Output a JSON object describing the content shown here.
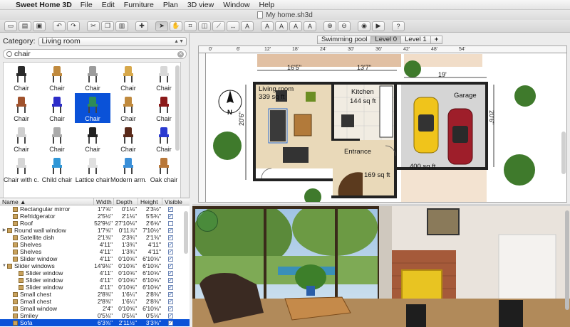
{
  "menubar": {
    "app_name": "Sweet Home 3D",
    "items": [
      "File",
      "Edit",
      "Furniture",
      "Plan",
      "3D view",
      "Window",
      "Help"
    ]
  },
  "window": {
    "title": "My home.sh3d"
  },
  "catalog": {
    "category_label": "Category:",
    "category_value": "Living room",
    "search_value": "chair",
    "items": [
      {
        "label": "Chair",
        "color": "#2a2a2a"
      },
      {
        "label": "Chair",
        "color": "#c08a3e"
      },
      {
        "label": "Chair",
        "color": "#9c9c9c"
      },
      {
        "label": "Chair",
        "color": "#d7a84b"
      },
      {
        "label": "Chair",
        "color": "#d8d8d8"
      },
      {
        "label": "Chair",
        "color": "#a0522d"
      },
      {
        "label": "Chair",
        "color": "#2d2dc8"
      },
      {
        "label": "Chair",
        "color": "#2e8b57"
      },
      {
        "label": "Chair",
        "color": "#c08a3e"
      },
      {
        "label": "Chair",
        "color": "#8b1a1a"
      },
      {
        "label": "Chair",
        "color": "#cfcfcf"
      },
      {
        "label": "Chair",
        "color": "#aaaaaa"
      },
      {
        "label": "Chair",
        "color": "#222222"
      },
      {
        "label": "Chair",
        "color": "#5a2a1a"
      },
      {
        "label": "Chair",
        "color": "#2a3ad0"
      },
      {
        "label": "Chair with c...",
        "color": "#d6d6d6"
      },
      {
        "label": "Child chair",
        "color": "#2f96d6"
      },
      {
        "label": "Lattice chair",
        "color": "#e0e0e0"
      },
      {
        "label": "Modern arm...",
        "color": "#3a8fd8"
      },
      {
        "label": "Oak chair",
        "color": "#b8783a"
      }
    ]
  },
  "table": {
    "headers": [
      "Name",
      "Width",
      "Depth",
      "Height",
      "Visible"
    ],
    "rows": [
      {
        "name": "Rectangular mirror",
        "w": "1'7⅝\"",
        "d": "0'1⅛\"",
        "h": "2'3½\"",
        "v": true,
        "indent": 1,
        "tw": ""
      },
      {
        "name": "Refridgerator",
        "w": "2'5½\"",
        "d": "2'1⅛\"",
        "h": "5'5¾\"",
        "v": true,
        "indent": 1,
        "tw": ""
      },
      {
        "name": "Roof",
        "w": "52'9½\"",
        "d": "27'10⅛\"",
        "h": "2'6⅝\"",
        "v": false,
        "indent": 1,
        "tw": ""
      },
      {
        "name": "Round wall window",
        "w": "1'7⅝\"",
        "d": "0'11⅞\"",
        "h": "7'10½\"",
        "v": true,
        "indent": 0,
        "tw": "▶"
      },
      {
        "name": "Satellite dish",
        "w": "2'1⅜\"",
        "d": "2'3¾\"",
        "h": "2'1⅜\"",
        "v": true,
        "indent": 1,
        "tw": ""
      },
      {
        "name": "Shelves",
        "w": "4'11\"",
        "d": "1'3¾\"",
        "h": "4'11\"",
        "v": true,
        "indent": 1,
        "tw": ""
      },
      {
        "name": "Shelves",
        "w": "4'11\"",
        "d": "1'3¾\"",
        "h": "4'11\"",
        "v": true,
        "indent": 1,
        "tw": ""
      },
      {
        "name": "Slider window",
        "w": "4'11\"",
        "d": "0'10⅝\"",
        "h": "6'10⅝\"",
        "v": true,
        "indent": 1,
        "tw": ""
      },
      {
        "name": "Slider windows",
        "w": "14'9⅛\"",
        "d": "0'10⅝\"",
        "h": "6'10⅝\"",
        "v": true,
        "indent": 0,
        "tw": "▼"
      },
      {
        "name": "Slider window",
        "w": "4'11\"",
        "d": "0'10⅝\"",
        "h": "6'10⅝\"",
        "v": true,
        "indent": 2,
        "tw": ""
      },
      {
        "name": "Slider window",
        "w": "4'11\"",
        "d": "0'10⅝\"",
        "h": "6'10⅝\"",
        "v": true,
        "indent": 2,
        "tw": ""
      },
      {
        "name": "Slider window",
        "w": "4'11\"",
        "d": "0'10⅝\"",
        "h": "6'10⅝\"",
        "v": true,
        "indent": 2,
        "tw": ""
      },
      {
        "name": "Small chest",
        "w": "2'8⅜\"",
        "d": "1'6¼\"",
        "h": "2'8⅜\"",
        "v": true,
        "indent": 1,
        "tw": ""
      },
      {
        "name": "Small chest",
        "w": "2'8⅜\"",
        "d": "1'6¼\"",
        "h": "2'8⅜\"",
        "v": true,
        "indent": 1,
        "tw": ""
      },
      {
        "name": "Small window",
        "w": "2'4\"",
        "d": "0'10⅝\"",
        "h": "6'10⅝\"",
        "v": true,
        "indent": 1,
        "tw": ""
      },
      {
        "name": "Smiley",
        "w": "0'5⅛\"",
        "d": "0'5⅛\"",
        "h": "0'5⅛\"",
        "v": true,
        "indent": 1,
        "tw": ""
      },
      {
        "name": "Sofa",
        "w": "6'3⅜\"",
        "d": "2'11½\"",
        "h": "3'3⅜\"",
        "v": true,
        "indent": 1,
        "tw": "",
        "selected": true
      }
    ]
  },
  "plan": {
    "levels": [
      "Swimming pool",
      "Level 0",
      "Level 1",
      "+"
    ],
    "active_level": "Level 0",
    "ruler_labels": [
      "0'",
      "6'",
      "12'",
      "18'",
      "24'",
      "30'",
      "36'",
      "42'",
      "48'",
      "54'"
    ],
    "dimensions": {
      "d1": "16'5\"",
      "d2": "13'7\"",
      "d3": "19'",
      "d4": "20'6\"",
      "d5": "20'6\""
    },
    "rooms": {
      "living": "Living room",
      "living_area": "339 sq ft",
      "kitchen": "Kitchen",
      "kitchen_area": "144 sq ft",
      "entrance": "Entrance",
      "entrance_area": "169 sq ft",
      "garage": "Garage",
      "garage_area": "400 sq ft"
    },
    "compass": "N"
  }
}
